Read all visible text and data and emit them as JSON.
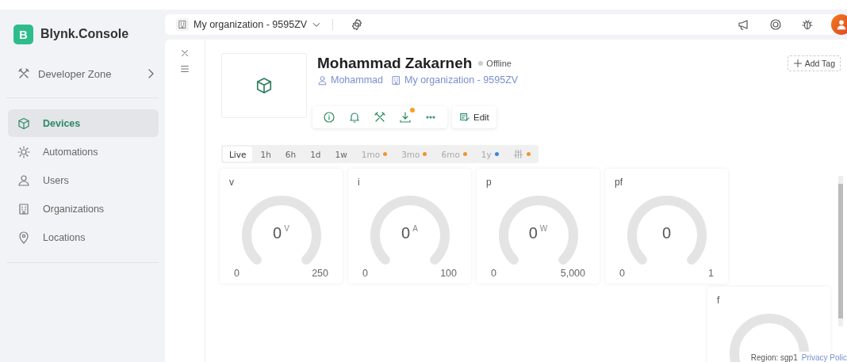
{
  "sidebar": {
    "brand": {
      "letter": "B",
      "name": "Blynk.Console"
    },
    "developer_zone": "Developer Zone",
    "items": [
      {
        "kind": "devices",
        "label": "Devices",
        "selected": true
      },
      {
        "kind": "automations",
        "label": "Automations",
        "selected": false
      },
      {
        "kind": "users",
        "label": "Users",
        "selected": false
      },
      {
        "kind": "organizations",
        "label": "Organizations",
        "selected": false
      },
      {
        "kind": "locations",
        "label": "Locations",
        "selected": false
      }
    ]
  },
  "header": {
    "organization": "My organization - 9595ZV"
  },
  "device": {
    "name": "Mohammad Zakarneh",
    "online": false,
    "status": "Offline",
    "owner": "Mohammad",
    "organization": "My organization - 9595ZV",
    "edit": "Edit",
    "add_tag": "Add Tag",
    "actions": [
      {
        "kind": "info",
        "badge": false
      },
      {
        "kind": "bell",
        "badge": false
      },
      {
        "kind": "tools",
        "badge": false
      },
      {
        "kind": "download",
        "badge": true
      },
      {
        "kind": "more",
        "badge": false
      }
    ]
  },
  "time_ranges": [
    {
      "label": "Live",
      "selected": true
    },
    {
      "label": "1h",
      "selected": false
    },
    {
      "label": "6h",
      "selected": false
    },
    {
      "label": "1d",
      "selected": false
    },
    {
      "label": "1w",
      "selected": false
    },
    {
      "label": "1mo",
      "selected": false,
      "color": "#f0962e"
    },
    {
      "label": "3mo",
      "selected": false,
      "color": "#f0962e"
    },
    {
      "label": "6mo",
      "selected": false,
      "color": "#f0962e"
    },
    {
      "label": "1y",
      "selected": false,
      "color": "#3a84e6"
    },
    {
      "kind": "icon",
      "selected": false,
      "color": "#f0962e"
    }
  ],
  "widgets": [
    {
      "title": "v",
      "value": "0",
      "unit": "V",
      "min": "0",
      "max": "250"
    },
    {
      "title": "i",
      "value": "0",
      "unit": "A",
      "min": "0",
      "max": "100"
    },
    {
      "title": "p",
      "value": "0",
      "unit": "W",
      "min": "0",
      "max": "5,000"
    },
    {
      "title": "pf",
      "value": "0",
      "min": "0",
      "max": "1"
    },
    {
      "title": "f"
    }
  ],
  "footer": {
    "region": "Region: sgp1",
    "privacy_link": "Privacy Polic"
  }
}
